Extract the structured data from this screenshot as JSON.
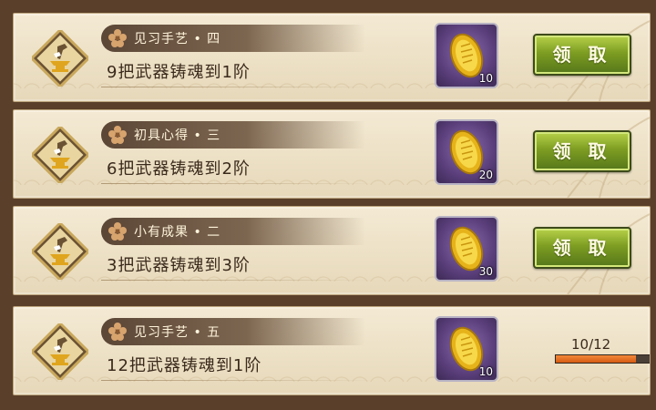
{
  "quests": [
    {
      "title": "见习手艺 • 四",
      "description": "9把武器铸魂到1阶",
      "reward_count": "10",
      "status": "claim",
      "button_label": "领 取"
    },
    {
      "title": "初具心得 • 三",
      "description": "6把武器铸魂到2阶",
      "reward_count": "20",
      "status": "claim",
      "button_label": "领 取"
    },
    {
      "title": "小有成果 • 二",
      "description": "3把武器铸魂到3阶",
      "reward_count": "30",
      "status": "claim",
      "button_label": "领 取"
    },
    {
      "title": "见习手艺 • 五",
      "description": "12把武器铸魂到1阶",
      "reward_count": "10",
      "status": "progress",
      "progress_text": "10/12",
      "progress_fraction": 0.8333
    }
  ],
  "icons": {
    "emblem": "anvil-emblem-icon",
    "title": "flower-icon",
    "reward": "gold-koban-icon"
  },
  "colors": {
    "claim_button": "#7d9d22",
    "progress_fill": "#e0701f",
    "reward_bg": "#5b3f7c"
  }
}
